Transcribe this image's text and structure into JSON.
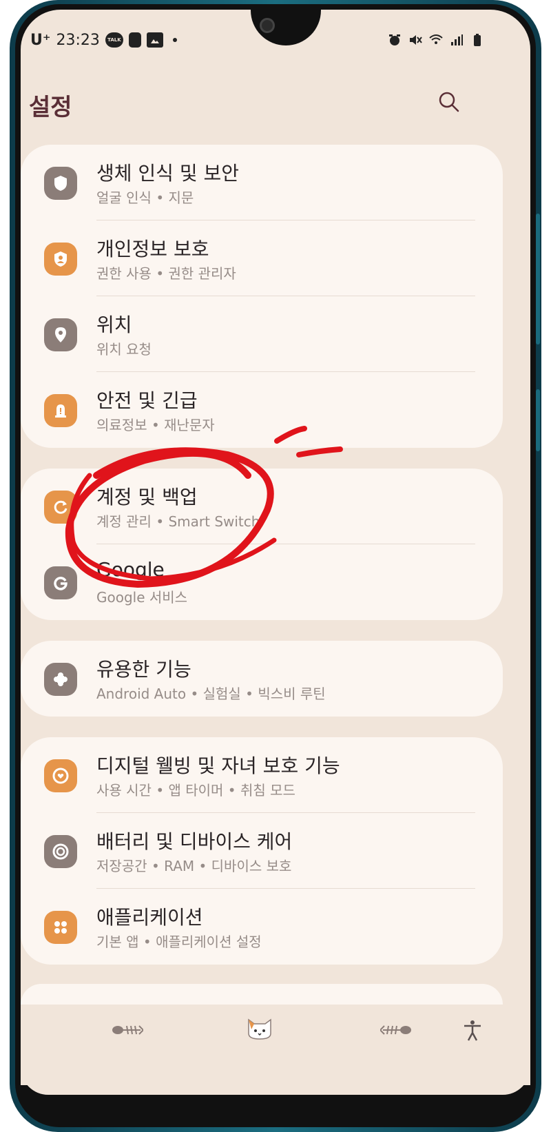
{
  "status_bar": {
    "carrier": "U⁺",
    "time": "23:23",
    "left_icons": [
      "talk-icon",
      "notification-icon",
      "gallery-icon"
    ],
    "right_icons": [
      "alarm-icon",
      "mute-icon",
      "wifi-icon",
      "signal-icon",
      "battery-icon"
    ],
    "talk_label": "TALK"
  },
  "header": {
    "title": "설정",
    "search_icon": "search-icon"
  },
  "groups": [
    {
      "items": [
        {
          "title": "생체 인식 및 보안",
          "subtitle": "얼굴 인식 • 지문",
          "icon": "shield-icon",
          "color": "#8b7d78"
        },
        {
          "title": "개인정보 보호",
          "subtitle": "권한 사용 • 권한 관리자",
          "icon": "privacy-icon",
          "color": "#e6954a"
        },
        {
          "title": "위치",
          "subtitle": "위치 요청",
          "icon": "location-icon",
          "color": "#8b7d78"
        },
        {
          "title": "안전 및 긴급",
          "subtitle": "의료정보 • 재난문자",
          "icon": "alert-icon",
          "color": "#e6954a"
        }
      ]
    },
    {
      "items": [
        {
          "title": "계정 및 백업",
          "subtitle": "계정 관리 • Smart Switch",
          "icon": "sync-icon",
          "color": "#e6954a"
        },
        {
          "title": "Google",
          "subtitle": "Google 서비스",
          "icon": "google-icon",
          "color": "#8b7d78"
        }
      ]
    },
    {
      "items": [
        {
          "title": "유용한 기능",
          "subtitle": "Android Auto • 실험실 • 빅스비 루틴",
          "icon": "puzzle-icon",
          "color": "#8b7d78"
        }
      ]
    },
    {
      "items": [
        {
          "title": "디지털 웰빙 및 자녀 보호 기능",
          "subtitle": "사용 시간 • 앱 타이머 • 취침 모드",
          "icon": "wellbeing-icon",
          "color": "#e6954a"
        },
        {
          "title": "배터리 및 디바이스 케어",
          "subtitle": "저장공간 • RAM • 디바이스 보호",
          "icon": "device-care-icon",
          "color": "#8b7d78"
        },
        {
          "title": "애플리케이션",
          "subtitle": "기본 앱 • 애플리케이션 설정",
          "icon": "apps-icon",
          "color": "#e6954a"
        }
      ]
    }
  ],
  "bottom_bar": {
    "icons": [
      "fishbone-left-icon",
      "cat-face-icon",
      "fishbone-right-icon",
      "accessibility-icon"
    ]
  },
  "colors": {
    "background": "#f1e5da",
    "card": "#fcf6f1",
    "title_text": "#5a2e36",
    "annotation_red": "#e0141b"
  }
}
